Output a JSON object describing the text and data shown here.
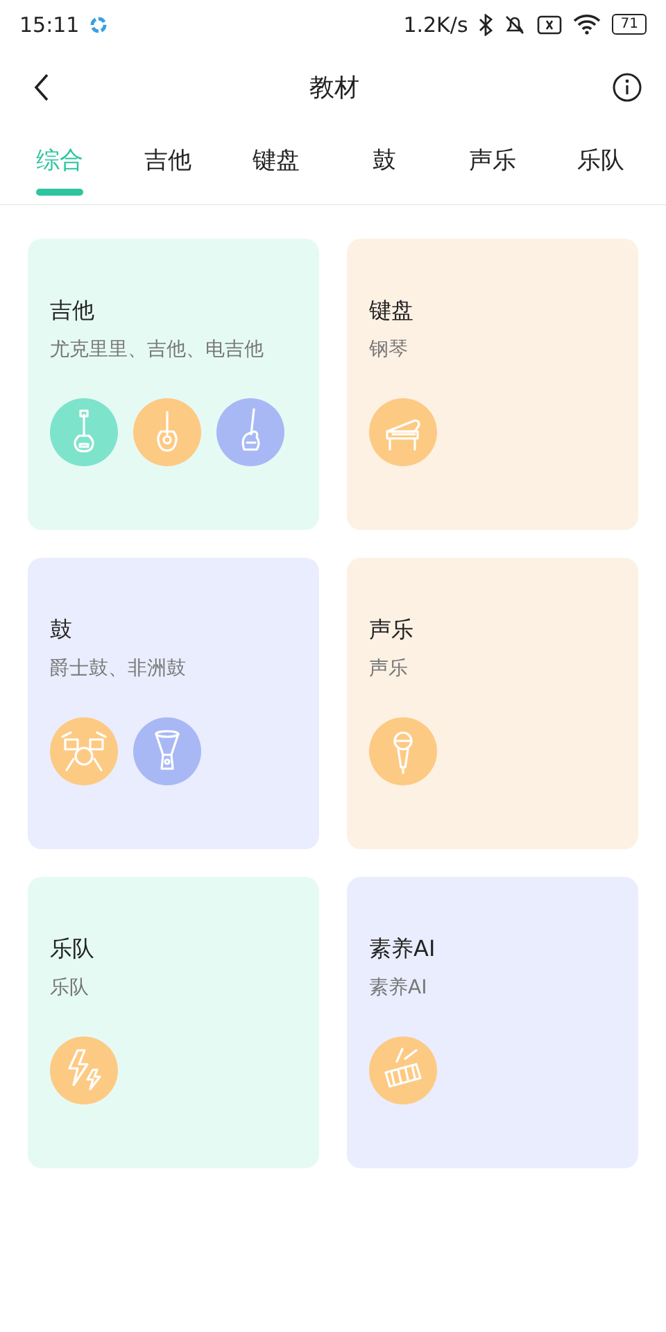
{
  "status_bar": {
    "time": "15:11",
    "speed": "1.2K/s",
    "battery": "71"
  },
  "header": {
    "title": "教材"
  },
  "tabs": [
    {
      "label": "综合",
      "selected": true
    },
    {
      "label": "吉他",
      "selected": false
    },
    {
      "label": "键盘",
      "selected": false
    },
    {
      "label": "鼓",
      "selected": false
    },
    {
      "label": "声乐",
      "selected": false
    },
    {
      "label": "乐队",
      "selected": false
    }
  ],
  "cards": [
    {
      "title": "吉他",
      "subtitle": "尤克里里、吉他、电吉他",
      "color": "#e6faf4",
      "icons": [
        {
          "kind": "ukulele",
          "color": "#7ee3cb"
        },
        {
          "kind": "guitar",
          "color": "#fdca84"
        },
        {
          "kind": "bass",
          "color": "#a8b8f5"
        }
      ]
    },
    {
      "title": "键盘",
      "subtitle": "钢琴",
      "color": "#fdf1e4",
      "icons": [
        {
          "kind": "piano",
          "color": "#fdca84"
        }
      ]
    },
    {
      "title": "鼓",
      "subtitle": "爵士鼓、非洲鼓",
      "color": "#eaedfd",
      "icons": [
        {
          "kind": "drums",
          "color": "#fdca84"
        },
        {
          "kind": "djembe",
          "color": "#a8b8f5"
        }
      ]
    },
    {
      "title": "声乐",
      "subtitle": "声乐",
      "color": "#fdf1e4",
      "icons": [
        {
          "kind": "microphone",
          "color": "#fdca84"
        }
      ]
    },
    {
      "title": "乐队",
      "subtitle": "乐队",
      "color": "#e6faf4",
      "icons": [
        {
          "kind": "lightning",
          "color": "#fdca84"
        }
      ]
    },
    {
      "title": "素养AI",
      "subtitle": "素养AI",
      "color": "#eaedfd",
      "icons": [
        {
          "kind": "xylophone",
          "color": "#fdca84"
        }
      ]
    }
  ]
}
